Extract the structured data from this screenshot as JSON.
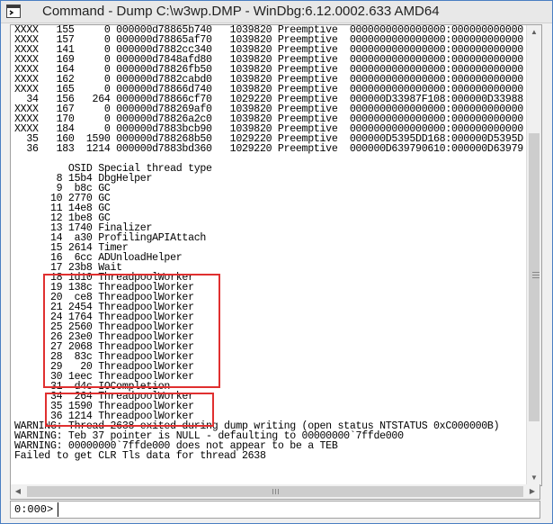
{
  "window": {
    "title": "Command - Dump C:\\w3wp.DMP - WinDbg:6.12.0002.633 AMD64",
    "icon": "console-window-icon"
  },
  "output_lines": [
    "XXXX   155     0 000000d78865b740   1039820 Preemptive  0000000000000000:000000000000",
    "XXXX   157     0 000000d78865af70   1039820 Preemptive  0000000000000000:000000000000",
    "XXXX   141     0 000000d7882cc340   1039820 Preemptive  0000000000000000:000000000000",
    "XXXX   169     0 000000d7848afd80   1039820 Preemptive  0000000000000000:000000000000",
    "XXXX   164     0 000000d78826fb50   1039820 Preemptive  0000000000000000:000000000000",
    "XXXX   162     0 000000d7882cabd0   1039820 Preemptive  0000000000000000:000000000000",
    "XXXX   165     0 000000d78866d740   1039820 Preemptive  0000000000000000:000000000000",
    "  34   156   264 000000d78866cf70   1029220 Preemptive  000000D33987F108:000000D33988",
    "XXXX   167     0 000000d788269af0   1039820 Preemptive  0000000000000000:000000000000",
    "XXXX   170     0 000000d78826a2c0   1039820 Preemptive  0000000000000000:000000000000",
    "XXXX   184     0 000000d7883bcb90   1039820 Preemptive  0000000000000000:000000000000",
    "  35   160  1590 000000d788268b50   1029220 Preemptive  000000D5395DD168:000000D5395D",
    "  36   183  1214 000000d7883bd360   1029220 Preemptive  000000D639790610:000000D63979",
    "",
    "         OSID Special thread type",
    "       8 15b4 DbgHelper",
    "       9  b8c GC",
    "      10 2770 GC",
    "      11 14e8 GC",
    "      12 1be8 GC",
    "      13 1740 Finalizer",
    "      14  a30 ProfilingAPIAttach",
    "      15 2614 Timer",
    "      16  6cc ADUnloadHelper",
    "      17 23b8 Wait",
    "      18 1d10 ThreadpoolWorker",
    "      19 138c ThreadpoolWorker",
    "      20  ce8 ThreadpoolWorker",
    "      21 2454 ThreadpoolWorker",
    "      24 1764 ThreadpoolWorker",
    "      25 2560 ThreadpoolWorker",
    "      26 23e0 ThreadpoolWorker",
    "      27 2068 ThreadpoolWorker",
    "      28  83c ThreadpoolWorker",
    "      29   20 ThreadpoolWorker",
    "      30 1eec ThreadpoolWorker",
    "      31  d4c IOCompletion",
    "      34  264 ThreadpoolWorker",
    "      35 1590 ThreadpoolWorker",
    "      36 1214 ThreadpoolWorker",
    "WARNING: Thread 2638 exited during dump writing (open status NTSTATUS 0xC000000B)",
    "WARNING: Teb 37 pointer is NULL - defaulting to 00000000`7ffde000",
    "WARNING: 00000000`7ffde000 does not appear to be a TEB",
    "Failed to get CLR Tls data for thread 2638"
  ],
  "command_bar": {
    "prompt": "0:000>",
    "value": ""
  },
  "colors": {
    "highlight_box": "#e03030",
    "window_border": "#4a7ec2"
  }
}
